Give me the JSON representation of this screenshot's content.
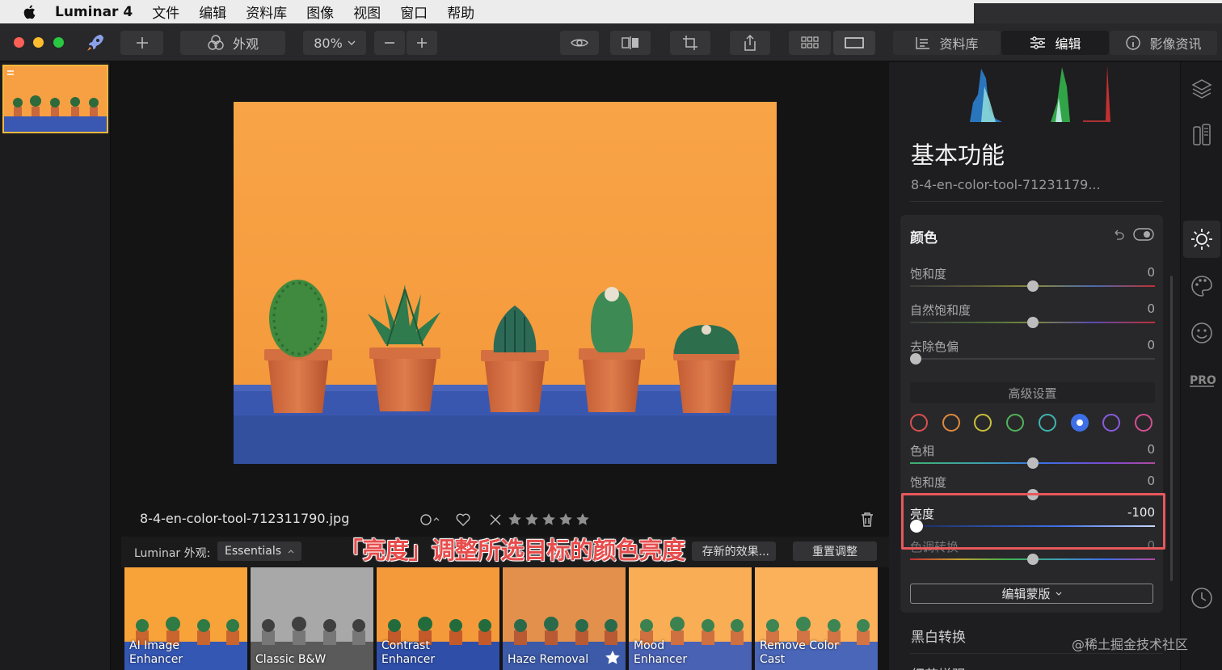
{
  "menubar": {
    "app": "Luminar 4",
    "items": [
      "文件",
      "编辑",
      "资料库",
      "图像",
      "视图",
      "窗口",
      "帮助"
    ]
  },
  "toolbar": {
    "looks_label": "外观",
    "zoom": "80%",
    "tabs": {
      "library": "资料库",
      "edit": "编辑",
      "info": "影像资讯"
    }
  },
  "canvas": {
    "filename": "8-4-en-color-tool-712311790.jpg",
    "rating_stars": 5
  },
  "looks_bar": {
    "label": "Luminar 外观:",
    "collection": "Essentials",
    "save_label": "存新的效果...",
    "reset_label": "重置调整"
  },
  "caption": "「亮度」调整所选目标的颜色亮度",
  "presets": [
    {
      "label": "AI Image\nEnhancer"
    },
    {
      "label": "Classic B&W"
    },
    {
      "label": "Contrast\nEnhancer"
    },
    {
      "label": "Haze Removal"
    },
    {
      "label": "Mood\nEnhancer"
    },
    {
      "label": "Remove Color\nCast"
    }
  ],
  "panel": {
    "title": "基本功能",
    "file_short": "8-4-en-color-tool-71231179...",
    "color_section": {
      "title": "颜色",
      "saturation": {
        "label": "饱和度",
        "value": "0",
        "level": 0.5
      },
      "vibrance": {
        "label": "自然饱和度",
        "value": "0",
        "level": 0.5
      },
      "remove_cast": {
        "label": "去除色偏",
        "value": "0",
        "level": 0.0
      },
      "advanced_label": "高级设置",
      "swatch_colors": [
        "#d9504e",
        "#e08a3c",
        "#c9c03a",
        "#52b35a",
        "#3fb5ae",
        "#3d6fe6",
        "#8a5bdc",
        "#d44f8f"
      ],
      "selected_swatch": 5,
      "hue": {
        "label": "色相",
        "value": "0",
        "level": 0.5
      },
      "sat2": {
        "label": "饱和度",
        "value": "0",
        "level": 0.5
      },
      "luminance": {
        "label": "亮度",
        "value": "-100",
        "level": 0.0
      },
      "shift_label": "色调转换",
      "shift": {
        "value": "0",
        "level": 0.5
      },
      "mask_label": "编辑蒙版"
    },
    "bw_label": "黑白转换",
    "next_label": "细节增强"
  },
  "watermark": "@稀土掘金技术社区",
  "colors": {
    "accent_red": "#e84c4c",
    "highlight_box": "#e8585a",
    "thumb_border": "#f0b83e",
    "orange_wall": "#f7a043",
    "blue_table": "#3a58b2"
  }
}
